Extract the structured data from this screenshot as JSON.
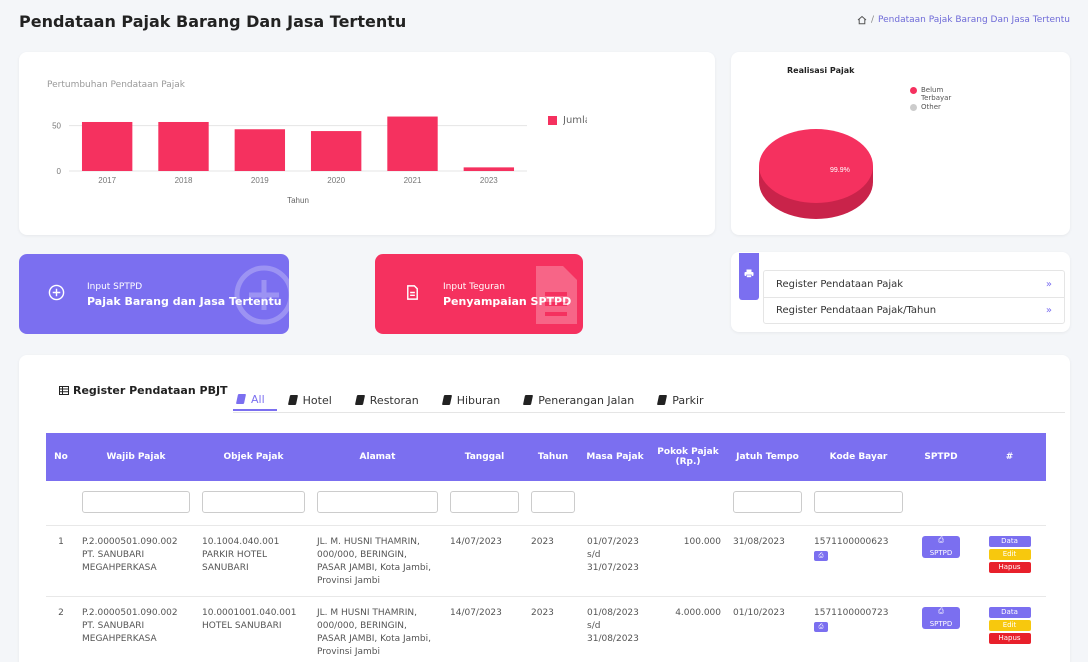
{
  "page": {
    "title": "Pendataan Pajak Barang Dan Jasa Tertentu"
  },
  "breadcrumb": {
    "current": "Pendataan Pajak Barang Dan Jasa Tertentu"
  },
  "chart_data": {
    "type": "bar",
    "title": "Pertumbuhan Pendataan Pajak",
    "xlabel": "Tahun",
    "ylabel": "",
    "categories": [
      "2017",
      "2018",
      "2019",
      "2020",
      "2021",
      "2023"
    ],
    "series": [
      {
        "name": "Jumlah",
        "values": [
          54,
          54,
          46,
          44,
          60,
          4
        ]
      }
    ],
    "yticks": [
      "0",
      "50"
    ],
    "ylim": [
      0,
      65
    ],
    "grid": true,
    "legend": "right",
    "color": "#f5315f"
  },
  "pie": {
    "title": "Realisasi Pajak",
    "slices": [
      {
        "name": "Belum Terbayar",
        "value": 99.9,
        "color": "#f5315f"
      },
      {
        "name": "Other",
        "value": 0.1,
        "color": "#cccccc"
      }
    ],
    "label": "99.9%"
  },
  "tiles": {
    "sptpd": {
      "line1": "Input SPTPD",
      "line2": "Pajak Barang dan Jasa Tertentu"
    },
    "teguran": {
      "line1": "Input Teguran",
      "line2": "Penyampaian SPTPD"
    }
  },
  "register_links": [
    {
      "label": "Register Pendataan Pajak",
      "arrow": "»"
    },
    {
      "label": "Register Pendataan Pajak/Tahun",
      "arrow": "»"
    }
  ],
  "table_section": {
    "title": "Register Pendataan PBJT",
    "tabs": [
      "All",
      "Hotel",
      "Restoran",
      "Hiburan",
      "Penerangan Jalan",
      "Parkir"
    ],
    "active_tab": "All"
  },
  "table": {
    "headers": [
      "No",
      "Wajib Pajak",
      "Objek Pajak",
      "Alamat",
      "Tanggal",
      "Tahun",
      "Masa Pajak",
      "Pokok Pajak (Rp.)",
      "Jatuh Tempo",
      "Kode Bayar",
      "SPTPD",
      "#"
    ],
    "rows": [
      {
        "no": "1",
        "wajib_pajak": "P.2.0000501.090.002 PT. SANUBARI MEGAHPERKASA",
        "objek_pajak": "10.1004.040.001 PARKIR HOTEL SANUBARI",
        "alamat": "JL. M. HUSNI THAMRIN, 000/000, BERINGIN, PASAR JAMBI, Kota Jambi, Provinsi Jambi",
        "tanggal": "14/07/2023",
        "tahun": "2023",
        "masa_pajak": "01/07/2023 s/d 31/07/2023",
        "pokok": "100.000",
        "jatuh_tempo": "31/08/2023",
        "kode_bayar": "1571100000623"
      },
      {
        "no": "2",
        "wajib_pajak": "P.2.0000501.090.002 PT. SANUBARI MEGAHPERKASA",
        "objek_pajak": "10.0001001.040.001 HOTEL SANUBARI",
        "alamat": "JL. M HUSNI THAMRIN, 000/000, BERINGIN, PASAR JAMBI, Kota Jambi, Provinsi Jambi",
        "tanggal": "14/07/2023",
        "tahun": "2023",
        "masa_pajak": "01/08/2023 s/d 31/08/2023",
        "pokok": "4.000.000",
        "jatuh_tempo": "01/10/2023",
        "kode_bayar": "1571100000723"
      }
    ],
    "buttons": {
      "sptpd": "SPTPD",
      "data": "Data",
      "edit": "Edit",
      "hapus": "Hapus"
    }
  }
}
